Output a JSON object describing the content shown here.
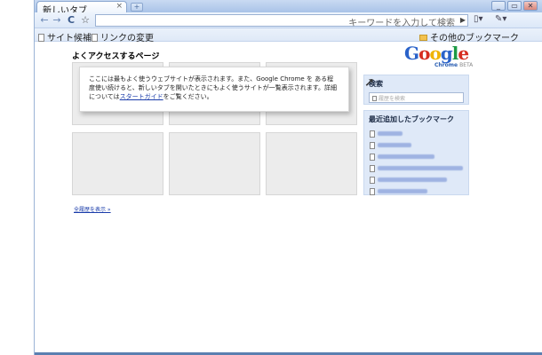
{
  "window": {
    "tab_title": "新しいタブ",
    "tab_close_glyph": "×",
    "new_tab_glyph": "+",
    "controls": [
      "_",
      "▭",
      "✕"
    ]
  },
  "toolbar": {
    "back_glyph": "←",
    "forward_glyph": "→",
    "reload_glyph": "C",
    "star_glyph": "☆",
    "omnibox_placeholder": "キーワードを入力して検索",
    "go_glyph": "▶",
    "page_menu_glyph": "▯▾",
    "tools_menu_glyph": "✎▾"
  },
  "bookmarks_bar": {
    "items": [
      "サイト候補",
      "リンクの変更"
    ],
    "other_bookmarks": "その他のブックマーク"
  },
  "main": {
    "most_visited_title": "よくアクセスするページ",
    "overlay_text_before": "ここには最もよく使うウェブサイトが表示されます。また、Google Chrome を ある程度使い続けると、新しいタブを開いたときにもよく使うサイトが一覧表示されます。詳細については",
    "overlay_link": "スタートガイド",
    "overlay_text_after": "をご覧ください。",
    "history_link": "全履歴を表示 »"
  },
  "logo": {
    "letters": [
      "G",
      "o",
      "o",
      "g",
      "l",
      "e"
    ],
    "sub": "Chrome",
    "beta": "BETA"
  },
  "search_panel": {
    "title": "検索",
    "placeholder": "履歴を検索"
  },
  "recent_bookmarks": {
    "title": "最近追加したブックマーク"
  },
  "colors": {
    "logo_blue": "#2a62c9",
    "logo_red": "#d62d20",
    "logo_yellow": "#f0b400",
    "logo_green": "#1d9a45",
    "panel_bg": "#dfe9f8",
    "link": "#1a3caa"
  }
}
